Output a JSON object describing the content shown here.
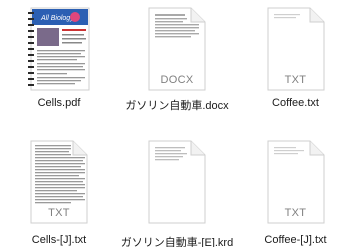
{
  "files": [
    {
      "name": "Cells.pdf",
      "kind": "pdf-thumbnail",
      "type_label": ""
    },
    {
      "name": "ガソリン自動車.docx",
      "kind": "docx",
      "type_label": "DOCX"
    },
    {
      "name": "Coffee.txt",
      "kind": "txt",
      "type_label": "TXT"
    },
    {
      "name": "Cells-[J].txt",
      "kind": "txt-dense",
      "type_label": "TXT"
    },
    {
      "name": "ガソリン自動車-[E].krd",
      "kind": "krd",
      "type_label": ""
    },
    {
      "name": "Coffee-[J].txt",
      "kind": "txt",
      "type_label": "TXT"
    }
  ],
  "colors": {
    "pdf_title_bg": "#2b5fb3",
    "accent_pink": "#e0467d"
  }
}
